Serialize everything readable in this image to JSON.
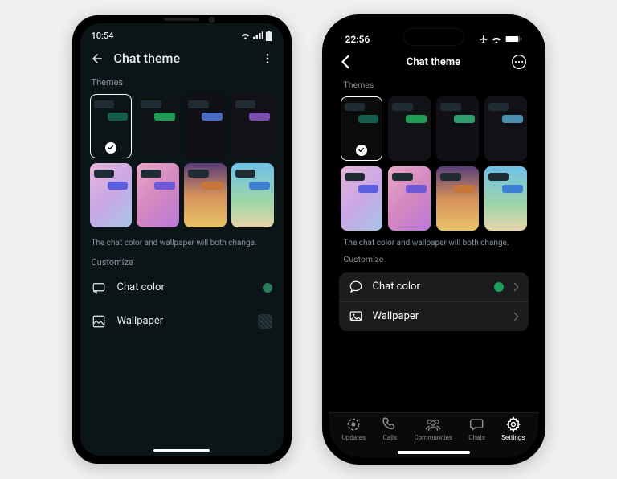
{
  "android": {
    "status": {
      "time": "10:54"
    },
    "title": "Chat theme",
    "themes_label": "Themes",
    "helper": "The chat color and wallpaper will both change.",
    "customize_label": "Customize",
    "chat_color_label": "Chat color",
    "wallpaper_label": "Wallpaper",
    "accent_color": "#2e7d5a",
    "themes": [
      {
        "bg": "#0b1416",
        "out": "#135b4a",
        "selected": true
      },
      {
        "bg": "#0f1417",
        "out": "#1f9d55"
      },
      {
        "bg": "#121017",
        "out": "#4a6cc7"
      },
      {
        "bg": "#141018",
        "out": "#7a4fb0"
      },
      {
        "cls": "bg-pastel",
        "out": "#5b5fe0"
      },
      {
        "cls": "bg-pink",
        "out": "#6e58d6"
      },
      {
        "cls": "bg-sunset",
        "out": "#c77538"
      },
      {
        "cls": "bg-beach",
        "out": "#3c7ed1"
      }
    ]
  },
  "iphone": {
    "status": {
      "time": "22:56"
    },
    "title": "Chat theme",
    "themes_label": "Themes",
    "helper": "The chat color and wallpaper will both change.",
    "customize_label": "Customize",
    "chat_color_label": "Chat color",
    "wallpaper_label": "Wallpaper",
    "accent_color": "#1d9d5e",
    "tabs": {
      "updates": "Updates",
      "calls": "Calls",
      "communities": "Communities",
      "chats": "Chats",
      "settings": "Settings"
    },
    "themes": [
      {
        "bg": "#0b0b0b",
        "out": "#135b4a",
        "selected": true
      },
      {
        "bg": "#111317",
        "out": "#1f9d55"
      },
      {
        "bg": "#121017",
        "out": "#2e9d6d"
      },
      {
        "bg": "#141018",
        "out": "#4a8fb0"
      },
      {
        "cls": "bg-pastel",
        "out": "#5b5fe0"
      },
      {
        "cls": "bg-pink",
        "out": "#6e58d6"
      },
      {
        "cls": "bg-sunset",
        "out": "#c77538"
      },
      {
        "cls": "bg-beach",
        "out": "#3c7ed1"
      }
    ]
  }
}
